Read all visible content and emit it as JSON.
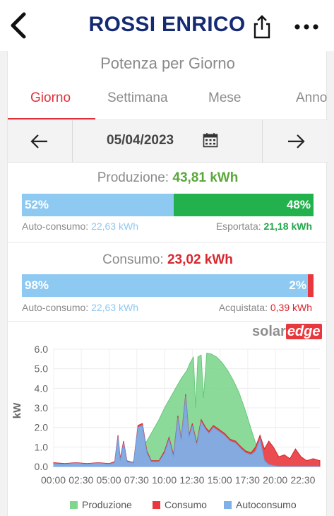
{
  "header": {
    "title": "ROSSI ENRICO",
    "back_icon": "chevron-left-icon",
    "share_icon": "share-icon",
    "more_icon": "more-horizontal-icon"
  },
  "card": {
    "title": "Potenza per Giorno"
  },
  "tabs": [
    {
      "label": "Giorno",
      "active": true
    },
    {
      "label": "Settimana",
      "active": false
    },
    {
      "label": "Mese",
      "active": false
    },
    {
      "label": "Anno",
      "active": false
    }
  ],
  "date_nav": {
    "date": "05/04/2023",
    "prev_icon": "arrow-left-icon",
    "next_icon": "arrow-right-icon",
    "calendar_icon": "calendar-icon"
  },
  "production": {
    "label": "Produzione: ",
    "value": "43,81 kWh",
    "self_pct": "52%",
    "export_pct": "48%",
    "self_fraction": 0.52,
    "left_label": "Auto-consumo: ",
    "left_value": "22,63 kWh",
    "right_label": "Esportata: ",
    "right_value": "21,18 kWh"
  },
  "consumption": {
    "label": "Consumo: ",
    "value": "23,02 kWh",
    "self_pct": "98%",
    "bought_pct": "2%",
    "self_fraction": 0.98,
    "left_label": "Auto-consumo: ",
    "left_value": "22,63 kWh",
    "right_label": "Acquistata: ",
    "right_value": "0,39 kWh"
  },
  "logo": {
    "solar": "solar",
    "edge": "edge"
  },
  "colors": {
    "title": "#142a73",
    "accent_red": "#e0303a",
    "production_green": "#22b14c",
    "production_area": "#7fd68f",
    "consumption_red": "#e8383d",
    "self_blue": "#8ec9f2",
    "selfcons_area": "#7fb0e8"
  },
  "chart_data": {
    "type": "area",
    "ylabel": "kW",
    "xlabel": "",
    "ylim": [
      0,
      6.0
    ],
    "yticks": [
      "0.0",
      "1.0",
      "2.0",
      "3.0",
      "4.0",
      "5.0",
      "6.0"
    ],
    "xticks": [
      "00:00",
      "02:30",
      "05:00",
      "07:30",
      "10:00",
      "12:30",
      "15:00",
      "17:30",
      "20:00",
      "22:30"
    ],
    "xlim_hours": [
      0,
      24
    ],
    "series": [
      {
        "name": "Produzione",
        "color": "#7fd68f",
        "points": [
          [
            0,
            0
          ],
          [
            6.5,
            0
          ],
          [
            7.0,
            0.1
          ],
          [
            7.5,
            0.6
          ],
          [
            8.0,
            0.9
          ],
          [
            8.5,
            1.4
          ],
          [
            9.0,
            1.9
          ],
          [
            9.5,
            2.4
          ],
          [
            10.0,
            3.0
          ],
          [
            10.5,
            3.5
          ],
          [
            11.0,
            4.0
          ],
          [
            11.5,
            4.5
          ],
          [
            12.0,
            4.9
          ],
          [
            12.3,
            5.3
          ],
          [
            12.6,
            5.6
          ],
          [
            12.8,
            3.0
          ],
          [
            13.0,
            5.6
          ],
          [
            13.3,
            5.7
          ],
          [
            13.5,
            3.5
          ],
          [
            13.8,
            5.8
          ],
          [
            14.2,
            5.75
          ],
          [
            14.7,
            5.6
          ],
          [
            15.2,
            5.3
          ],
          [
            15.7,
            4.9
          ],
          [
            16.2,
            4.4
          ],
          [
            16.7,
            3.8
          ],
          [
            17.2,
            3.0
          ],
          [
            17.7,
            2.1
          ],
          [
            18.2,
            1.2
          ],
          [
            18.7,
            0.5
          ],
          [
            19.2,
            0.1
          ],
          [
            19.7,
            0
          ],
          [
            24,
            0
          ]
        ]
      },
      {
        "name": "Consumo",
        "color": "#e8383d",
        "points": [
          [
            0,
            0.2
          ],
          [
            1,
            0.15
          ],
          [
            2,
            0.2
          ],
          [
            3,
            0.15
          ],
          [
            4,
            0.2
          ],
          [
            5,
            0.15
          ],
          [
            5.5,
            0.25
          ],
          [
            5.8,
            1.6
          ],
          [
            6.0,
            0.4
          ],
          [
            6.3,
            1.3
          ],
          [
            6.6,
            0.3
          ],
          [
            7.2,
            0.2
          ],
          [
            7.6,
            2.1
          ],
          [
            8.0,
            2.2
          ],
          [
            8.4,
            0.8
          ],
          [
            8.8,
            0.3
          ],
          [
            9.5,
            0.3
          ],
          [
            10.0,
            0.8
          ],
          [
            10.4,
            1.5
          ],
          [
            10.8,
            0.6
          ],
          [
            11.2,
            2.6
          ],
          [
            11.5,
            1.4
          ],
          [
            11.9,
            3.7
          ],
          [
            12.2,
            1.6
          ],
          [
            12.5,
            2.2
          ],
          [
            12.9,
            1.2
          ],
          [
            13.3,
            2.4
          ],
          [
            13.7,
            2.0
          ],
          [
            14.0,
            1.8
          ],
          [
            14.4,
            2.1
          ],
          [
            14.9,
            1.9
          ],
          [
            15.4,
            1.7
          ],
          [
            15.9,
            1.4
          ],
          [
            16.4,
            1.3
          ],
          [
            16.9,
            1.0
          ],
          [
            17.3,
            0.8
          ],
          [
            17.8,
            0.7
          ],
          [
            18.2,
            1.0
          ],
          [
            18.6,
            1.6
          ],
          [
            19.0,
            0.9
          ],
          [
            19.4,
            1.3
          ],
          [
            19.8,
            1.0
          ],
          [
            20.3,
            0.5
          ],
          [
            20.8,
            0.6
          ],
          [
            21.3,
            0.4
          ],
          [
            21.8,
            0.9
          ],
          [
            22.3,
            0.5
          ],
          [
            22.8,
            0.3
          ],
          [
            23.4,
            0.4
          ],
          [
            24,
            0.3
          ]
        ]
      },
      {
        "name": "Autoconsumo",
        "color": "#7fb0e8",
        "points": [
          [
            0,
            0.15
          ],
          [
            1,
            0.12
          ],
          [
            2,
            0.18
          ],
          [
            3,
            0.12
          ],
          [
            4,
            0.18
          ],
          [
            5,
            0.12
          ],
          [
            5.5,
            0.2
          ],
          [
            5.8,
            1.5
          ],
          [
            6.0,
            0.3
          ],
          [
            6.3,
            1.2
          ],
          [
            6.6,
            0.25
          ],
          [
            7.2,
            0.18
          ],
          [
            7.6,
            2.0
          ],
          [
            8.0,
            2.1
          ],
          [
            8.4,
            0.7
          ],
          [
            8.8,
            0.25
          ],
          [
            9.5,
            0.25
          ],
          [
            10.0,
            0.7
          ],
          [
            10.4,
            1.4
          ],
          [
            10.8,
            0.5
          ],
          [
            11.2,
            2.5
          ],
          [
            11.5,
            1.3
          ],
          [
            11.9,
            3.6
          ],
          [
            12.2,
            1.5
          ],
          [
            12.5,
            2.1
          ],
          [
            12.9,
            1.1
          ],
          [
            13.3,
            2.3
          ],
          [
            13.7,
            1.9
          ],
          [
            14.0,
            1.7
          ],
          [
            14.4,
            2.0
          ],
          [
            14.9,
            1.8
          ],
          [
            15.4,
            1.6
          ],
          [
            15.9,
            1.3
          ],
          [
            16.4,
            1.2
          ],
          [
            16.9,
            0.9
          ],
          [
            17.3,
            0.7
          ],
          [
            17.8,
            0.6
          ],
          [
            18.2,
            0.8
          ],
          [
            18.6,
            1.4
          ],
          [
            19.0,
            0.3
          ],
          [
            19.4,
            0.1
          ],
          [
            19.8,
            0.05
          ],
          [
            20.3,
            0
          ],
          [
            24,
            0
          ]
        ]
      }
    ],
    "legend": [
      "Produzione",
      "Consumo",
      "Autoconsumo"
    ],
    "legend_position": "bottom",
    "grid": true
  }
}
